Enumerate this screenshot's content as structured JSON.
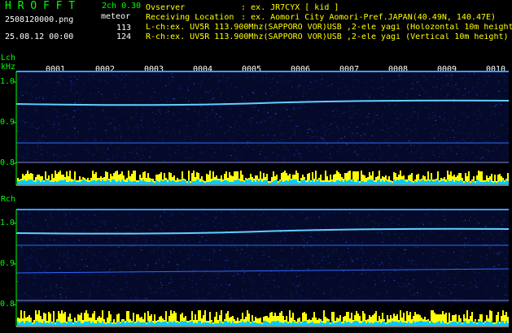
{
  "header": {
    "title": "H R O F F T",
    "mode": "2ch 0.30",
    "filename": "2508120000.png",
    "meteor_label": "meteor",
    "lch_count": "113",
    "rch_count": "124",
    "datetime": "25.08.12 00:00",
    "observer_label": "Ovserver",
    "observer_value": ": ex. JR7CYX [ kid ]",
    "location_label": "Receiving Location",
    "location_value": ": ex. Aomori City Aomori-Pref.JAPAN(40.49N, 140.47E)",
    "lch_info": "L-ch:ex. UV5R 113.900Mhz(SAPPORO VOR)USB ,2-ele yagi (Holozontal 10m height)",
    "rch_info": "R-ch:ex. UV5R 113.900Mhz(SAPPORO VOR)USB ,2-ele yagi (Vertical 10m height)"
  },
  "lch": {
    "label": "Lch",
    "unit": "kHz",
    "ticks": [
      "1.0",
      "0.9",
      "0.8"
    ],
    "markers": [
      "0001",
      "0002",
      "0003",
      "0004",
      "0005",
      "0006",
      "0007",
      "0008",
      "0009",
      "0010"
    ]
  },
  "rch": {
    "label": "Rch",
    "ticks": [
      "1.0",
      "0.9",
      "0.8"
    ]
  },
  "colors": {
    "background": "#000000",
    "label_green": "#00ff00",
    "text_white": "#ffffff",
    "text_yellow": "#ffff00",
    "noise_blue": "#0a1a66",
    "signal_cyan": "#33ccff",
    "bar_yellow": "#ffff00",
    "bar_cyan": "#00ccff"
  }
}
